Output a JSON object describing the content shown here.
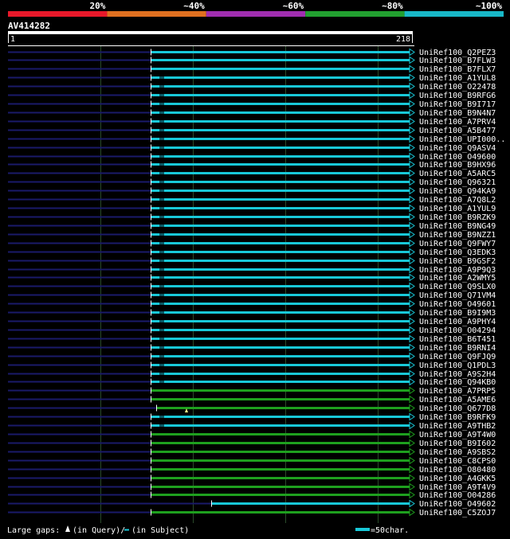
{
  "scale": {
    "labels": [
      "20%",
      "~40%",
      "~60%",
      "~80%",
      "~100%"
    ],
    "colors": [
      "#e8182a",
      "#e07020",
      "#a02eb0",
      "#22a030",
      "#18b8c8"
    ]
  },
  "query": {
    "name": "AV414282",
    "start": "1",
    "end": "218"
  },
  "colors": {
    "background": "#000000",
    "query_line": "#1a1a6a",
    "hit_cyan": "#18c8d8",
    "hit_green": "#1ea01e",
    "grid": "#2a4a2a"
  },
  "hits": [
    {
      "label": "UniRef100_Q2PEZ3",
      "color": "cyan"
    },
    {
      "label": "UniRef100_B7FLW3",
      "color": "cyan"
    },
    {
      "label": "UniRef100_B7FLX7",
      "color": "cyan"
    },
    {
      "label": "UniRef100_A1YUL8",
      "color": "cyan"
    },
    {
      "label": "UniRef100_O22478",
      "color": "cyan"
    },
    {
      "label": "UniRef100_B9RFG6",
      "color": "cyan"
    },
    {
      "label": "UniRef100_B9I717",
      "color": "cyan"
    },
    {
      "label": "UniRef100_B9N4N7",
      "color": "cyan"
    },
    {
      "label": "UniRef100_A7PRV4",
      "color": "cyan"
    },
    {
      "label": "UniRef100_A5B477",
      "color": "cyan"
    },
    {
      "label": "UniRef100_UPI000..",
      "color": "cyan"
    },
    {
      "label": "UniRef100_Q9ASV4",
      "color": "cyan"
    },
    {
      "label": "UniRef100_O49600",
      "color": "cyan"
    },
    {
      "label": "UniRef100_B9HX96",
      "color": "cyan"
    },
    {
      "label": "UniRef100_A5ARC5",
      "color": "cyan"
    },
    {
      "label": "UniRef100_Q96321",
      "color": "cyan"
    },
    {
      "label": "UniRef100_Q94KA9",
      "color": "cyan"
    },
    {
      "label": "UniRef100_A7Q8L2",
      "color": "cyan"
    },
    {
      "label": "UniRef100_A1YUL9",
      "color": "cyan"
    },
    {
      "label": "UniRef100_B9RZK9",
      "color": "cyan"
    },
    {
      "label": "UniRef100_B9NG49",
      "color": "cyan"
    },
    {
      "label": "UniRef100_B9NZZ1",
      "color": "cyan"
    },
    {
      "label": "UniRef100_Q9FWY7",
      "color": "cyan"
    },
    {
      "label": "UniRef100_Q3EDK3",
      "color": "cyan"
    },
    {
      "label": "UniRef100_B9GSF2",
      "color": "cyan"
    },
    {
      "label": "UniRef100_A9P9Q3",
      "color": "cyan"
    },
    {
      "label": "UniRef100_A2WMY5",
      "color": "cyan"
    },
    {
      "label": "UniRef100_Q9SLX0",
      "color": "cyan"
    },
    {
      "label": "UniRef100_Q71VM4",
      "color": "cyan"
    },
    {
      "label": "UniRef100_O49601",
      "color": "cyan"
    },
    {
      "label": "UniRef100_B9I9M3",
      "color": "cyan"
    },
    {
      "label": "UniRef100_A9PHY4",
      "color": "cyan"
    },
    {
      "label": "UniRef100_O04294",
      "color": "cyan"
    },
    {
      "label": "UniRef100_B6T451",
      "color": "cyan"
    },
    {
      "label": "UniRef100_B9RNI4",
      "color": "cyan"
    },
    {
      "label": "UniRef100_Q9FJQ9",
      "color": "cyan"
    },
    {
      "label": "UniRef100_Q1PDL3",
      "color": "cyan"
    },
    {
      "label": "UniRef100_A9S2H4",
      "color": "cyan"
    },
    {
      "label": "UniRef100_Q94KB0",
      "color": "cyan"
    },
    {
      "label": "UniRef100_A7PRP5",
      "color": "green"
    },
    {
      "label": "UniRef100_A5AME6",
      "color": "green"
    },
    {
      "label": "UniRef100_Q677D8",
      "color": "green"
    },
    {
      "label": "UniRef100_B9RFK9",
      "color": "cyan"
    },
    {
      "label": "UniRef100_A9THB2",
      "color": "cyan"
    },
    {
      "label": "UniRef100_A9T4W0",
      "color": "green"
    },
    {
      "label": "UniRef100_B9I602",
      "color": "green"
    },
    {
      "label": "UniRef100_A9SBS2",
      "color": "green"
    },
    {
      "label": "UniRef100_C8CPS0",
      "color": "green"
    },
    {
      "label": "UniRef100_O80480",
      "color": "green"
    },
    {
      "label": "UniRef100_A4GKK5",
      "color": "green"
    },
    {
      "label": "UniRef100_A9T4V9",
      "color": "green"
    },
    {
      "label": "UniRef100_O04286",
      "color": "green"
    },
    {
      "label": "UniRef100_O49602",
      "color": "cyan"
    },
    {
      "label": "UniRef100_C5ZOJ7",
      "color": "green"
    }
  ],
  "footer": {
    "gaps_label": "Large gaps:",
    "gaps_query": "(in Query)/",
    "gaps_subject": "(in Subject)",
    "scale_label": "=50char."
  }
}
